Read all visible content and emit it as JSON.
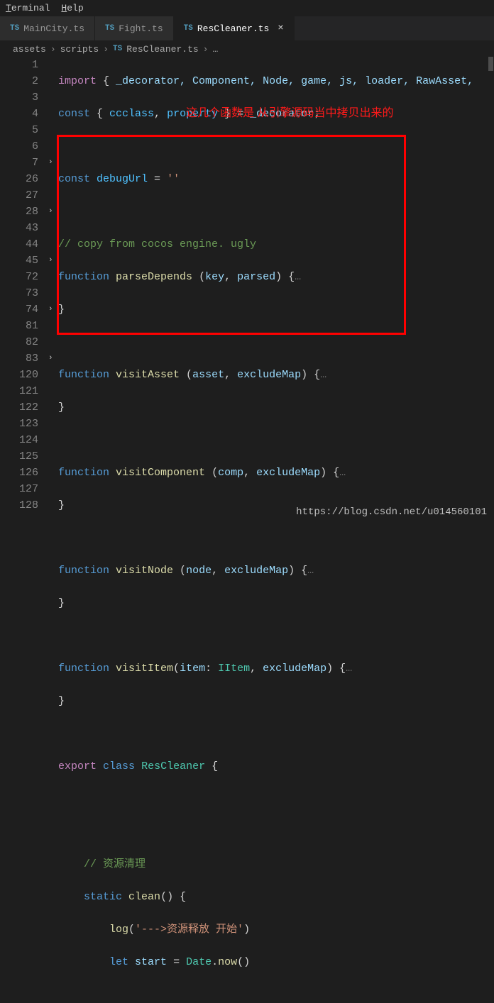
{
  "menu": {
    "terminal": "Terminal",
    "help": "Help"
  },
  "tabs": [
    {
      "label": "MainCity.ts"
    },
    {
      "label": "Fight.ts"
    },
    {
      "label": "ResCleaner.ts"
    }
  ],
  "breadcrumb": {
    "parts": [
      "assets",
      "scripts",
      "ResCleaner.ts",
      "…"
    ]
  },
  "annotation_text": "这几个函数是 从引擎源码当中拷贝出来的",
  "watermark": "https://blog.csdn.net/u014560101",
  "line_numbers": [
    1,
    2,
    3,
    4,
    5,
    6,
    7,
    26,
    27,
    28,
    43,
    44,
    45,
    72,
    73,
    74,
    81,
    82,
    83,
    120,
    121,
    122,
    123,
    124,
    125,
    126,
    127,
    128
  ],
  "fold_marks": {
    "7": "›",
    "28": "›",
    "45": "›",
    "74": "›",
    "83": "›"
  },
  "code": {
    "l1_import": "import",
    "l1_brace_o": " { ",
    "l1_names": "_decorator, Component, Node, game, js, loader, RawAsset,",
    "l1_brace_c": " ",
    "l2_const": "const",
    "l2_destr": " { ",
    "l2_cc": "ccclass",
    "l2_c": ", ",
    "l2_prop": "property",
    "l2_cb": " } = ",
    "l2_dec": "_decorator",
    "l2_semi": ";",
    "l4_const": "const",
    "l4_sp": " ",
    "l4_dbg": "debugUrl",
    "l4_eq": " = ",
    "l4_str": "''",
    "l6_com": "// copy from cocos engine. ugly",
    "l7_fn": "function",
    "l7_sp": " ",
    "l7_name": "parseDepends",
    "l7_sig": " (",
    "l7_a1": "key",
    "l7_c": ", ",
    "l7_a2": "parsed",
    "l7_end": ") {",
    "l7_ell": "…",
    "l26_cb": "}",
    "l28_fn": "function",
    "l28_sp": " ",
    "l28_name": "visitAsset",
    "l28_sig": " (",
    "l28_a1": "asset",
    "l28_c": ", ",
    "l28_a2": "excludeMap",
    "l28_end": ") {",
    "l28_ell": "…",
    "l43_cb": "}",
    "l45_fn": "function",
    "l45_sp": " ",
    "l45_name": "visitComponent",
    "l45_sig": " (",
    "l45_a1": "comp",
    "l45_c": ", ",
    "l45_a2": "excludeMap",
    "l45_end": ") {",
    "l45_ell": "…",
    "l72_cb": "}",
    "l74_fn": "function",
    "l74_sp": " ",
    "l74_name": "visitNode",
    "l74_sig": " (",
    "l74_a1": "node",
    "l74_c": ", ",
    "l74_a2": "excludeMap",
    "l74_end": ") {",
    "l74_ell": "…",
    "l81_cb": "}",
    "l83_fn": "function",
    "l83_sp": " ",
    "l83_name": "visitItem",
    "l83_sig": "(",
    "l83_a1": "item",
    "l83_col": ": ",
    "l83_t": "IItem",
    "l83_c": ", ",
    "l83_a2": "excludeMap",
    "l83_end": ") {",
    "l83_ell": "…",
    "l120_cb": "}",
    "l122_exp": "export",
    "l122_sp": " ",
    "l122_cls": "class",
    "l122_sp2": " ",
    "l122_name": "ResCleaner",
    "l122_ob": " {",
    "l125_com": "// 资源清理",
    "l126_static": "static",
    "l126_sp": " ",
    "l126_name": "clean",
    "l126_sig": "() {",
    "l127_log": "log",
    "l127_op": "(",
    "l127_str": "'--->资源释放 开始'",
    "l127_cp": ")",
    "l128_let": "let",
    "l128_sp": " ",
    "l128_var": "start",
    "l128_eq": " = ",
    "l128_date": "Date",
    "l128_dot": ".",
    "l128_now": "now",
    "l128_call": "()"
  }
}
